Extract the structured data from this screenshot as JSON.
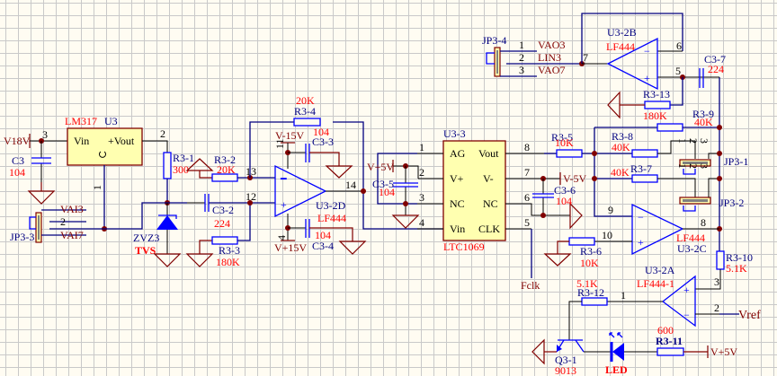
{
  "power": {
    "v18": "V18V",
    "vm15": "V-15V",
    "vp15": "V+15V",
    "vp5_ltc": "V+5V",
    "vm5": "V-5V",
    "vp5_led": "V+5V"
  },
  "nets": {
    "vai3": "VAI3",
    "vai7": "VAI7",
    "vao3": "VAO3",
    "lin3": "LIN3",
    "vao7": "VAO7",
    "fclk": "Fclk",
    "vref": "Vref"
  },
  "u3": {
    "ref": "U3",
    "part": "LM317",
    "vin": "Vin",
    "vout": "+Vout",
    "pin_in": "3",
    "pin_out": "2",
    "pin_adj": "1"
  },
  "u33": {
    "ref": "U3-3",
    "part": "LTC1069",
    "left": [
      "AG",
      "V+",
      "NC",
      "Vin"
    ],
    "right": [
      "Vout",
      "V-",
      "NC",
      "CLK"
    ],
    "pins_left": [
      "1",
      "2",
      "3",
      "4"
    ],
    "pins_right": [
      "8",
      "7",
      "6",
      "5"
    ]
  },
  "opamps": {
    "d": {
      "ref": "U3-2D",
      "part": "LF444",
      "pin_out": "14",
      "pin_neg": "13",
      "pin_pos": "12",
      "pin_vm": "11",
      "pin_vp": "4"
    },
    "b": {
      "ref": "U3-2B",
      "part": "LF444",
      "pin_out": "7",
      "pin_neg": "6",
      "pin_pos": "5"
    },
    "c": {
      "ref": "U3-2C",
      "part": "LF444",
      "pin_out": "8",
      "pin_neg": "9",
      "pin_pos": "10"
    },
    "a": {
      "ref": "U3-2A",
      "part": "LF444-1",
      "pin_out": "1",
      "pin_neg": "2",
      "pin_pos": "3"
    }
  },
  "resistors": {
    "r31": {
      "ref": "R3-1",
      "value": "300"
    },
    "r32": {
      "ref": "R3-2",
      "value": "20K"
    },
    "r33": {
      "ref": "R3-3",
      "value": "180K"
    },
    "r34": {
      "ref": "R3-4",
      "value": "20K"
    },
    "r35": {
      "ref": "R3-5",
      "value": "10K"
    },
    "r36": {
      "ref": "R3-6",
      "value": "10K"
    },
    "r37": {
      "ref": "R3-7",
      "value": "40K"
    },
    "r38": {
      "ref": "R3-8",
      "value": "40K"
    },
    "r39": {
      "ref": "R3-9",
      "value": "40K"
    },
    "r310": {
      "ref": "R3-10",
      "value": "5.1K"
    },
    "r311": {
      "ref": "R3-11",
      "value": "600"
    },
    "r312": {
      "ref": "R3-12",
      "value": "5.1K"
    },
    "r313": {
      "ref": "R3-13",
      "value": "180K"
    }
  },
  "capacitors": {
    "c3": {
      "ref": "C3",
      "value": "104"
    },
    "c32": {
      "ref": "C3-2",
      "value": "224"
    },
    "c33": {
      "ref": "C3-3",
      "value": "104"
    },
    "c34": {
      "ref": "C3-4",
      "value": "104"
    },
    "c35": {
      "ref": "C3-5",
      "value": "104"
    },
    "c36": {
      "ref": "C3-6",
      "value": "104"
    },
    "c37": {
      "ref": "C3-7",
      "value": "224"
    }
  },
  "connectors": {
    "jp33": {
      "ref": "JP3-3",
      "pin2": "2"
    },
    "jp34": {
      "ref": "JP3-4",
      "pins": [
        "1",
        "2",
        "3"
      ]
    },
    "jp31": {
      "ref": "JP3-1",
      "pins": [
        "1",
        "2",
        "3"
      ]
    },
    "jp32": {
      "ref": "JP3-2",
      "pins": [
        "1",
        "2",
        "3"
      ]
    }
  },
  "diode": {
    "ref": "ZVZ3",
    "value": "TVS"
  },
  "transistor": {
    "ref": "Q3-1",
    "value": "9013"
  },
  "led": {
    "value": "LED"
  },
  "colors": {
    "wire": "#000080",
    "component": "#0000ff",
    "value_text": "#ff0000",
    "power": "#800000",
    "ic_fill": "#ffffb0"
  }
}
